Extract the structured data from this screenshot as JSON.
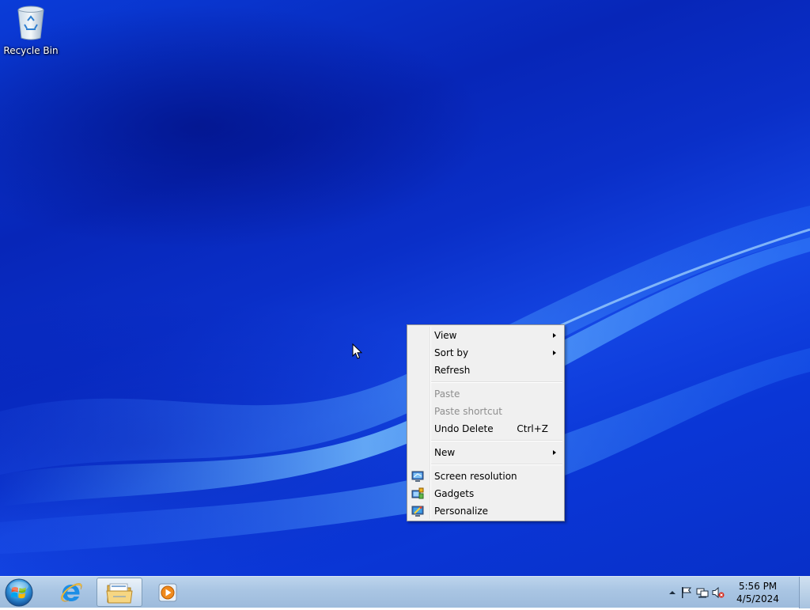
{
  "desktop": {
    "icons": [
      {
        "label": "Recycle Bin",
        "icon": "recycle-bin-icon"
      }
    ]
  },
  "context_menu": {
    "items": [
      {
        "label": "View",
        "submenu": true,
        "enabled": true
      },
      {
        "label": "Sort by",
        "submenu": true,
        "enabled": true
      },
      {
        "label": "Refresh",
        "enabled": true
      },
      {
        "label": "Paste",
        "enabled": false
      },
      {
        "label": "Paste shortcut",
        "enabled": false
      },
      {
        "label": "Undo Delete",
        "shortcut": "Ctrl+Z",
        "enabled": true
      },
      {
        "label": "New",
        "submenu": true,
        "enabled": true
      },
      {
        "label": "Screen resolution",
        "icon": "display-icon",
        "enabled": true
      },
      {
        "label": "Gadgets",
        "icon": "gadgets-icon",
        "enabled": true
      },
      {
        "label": "Personalize",
        "icon": "personalize-icon",
        "enabled": true
      }
    ]
  },
  "taskbar": {
    "start": {
      "icon": "windows-orb-icon"
    },
    "pinned": [
      {
        "name": "Internet Explorer",
        "icon": "internet-explorer-icon",
        "active": false
      },
      {
        "name": "Windows Explorer",
        "icon": "folder-icon",
        "active": true
      },
      {
        "name": "Windows Media Player",
        "icon": "media-player-icon",
        "active": false
      }
    ],
    "tray": {
      "icons": [
        "show-hidden-icons-icon",
        "action-center-flag-icon",
        "network-icon",
        "volume-muted-icon"
      ],
      "time": "5:56 PM",
      "date": "4/5/2024"
    }
  },
  "colors": {
    "desktop_blue": "#0a36d6",
    "taskbar": "#a9c5e3",
    "menu_bg": "#f0f0f0",
    "disabled_text": "#8e8e8e"
  }
}
